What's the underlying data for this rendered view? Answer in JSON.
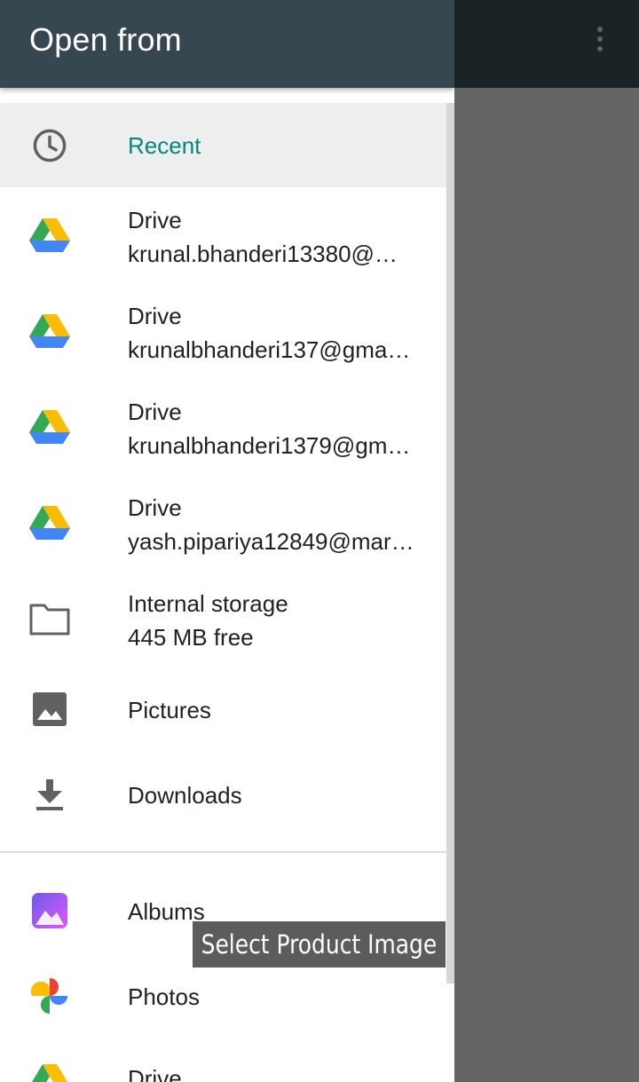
{
  "header": {
    "title": "Open from",
    "menu_icon": "more-vert-icon"
  },
  "items": [
    {
      "key": "recent",
      "label": "Recent",
      "icon": "clock-icon",
      "selected": true
    },
    {
      "key": "drive1",
      "label": "Drive",
      "sub": "krunal.bhanderi13380@…",
      "icon": "google-drive-icon"
    },
    {
      "key": "drive2",
      "label": "Drive",
      "sub": "krunalbhanderi137@gma…",
      "icon": "google-drive-icon"
    },
    {
      "key": "drive3",
      "label": "Drive",
      "sub": "krunalbhanderi1379@gm…",
      "icon": "google-drive-icon"
    },
    {
      "key": "drive4",
      "label": "Drive",
      "sub": "yash.pipariya12849@mar…",
      "icon": "google-drive-icon"
    },
    {
      "key": "storage",
      "label": "Internal storage",
      "sub": "445 MB free",
      "icon": "folder-icon"
    },
    {
      "key": "pictures",
      "label": "Pictures",
      "icon": "image-icon"
    },
    {
      "key": "downloads",
      "label": "Downloads",
      "icon": "download-icon"
    },
    {
      "key": "albums",
      "label": "Albums",
      "icon": "albums-app-icon"
    },
    {
      "key": "photos",
      "label": "Photos",
      "icon": "google-photos-icon"
    },
    {
      "key": "drive5",
      "label": "Drive",
      "icon": "google-drive-icon"
    }
  ],
  "toast": {
    "text": "Select Product Image"
  },
  "colors": {
    "header": "#37474f",
    "accent": "#00897b",
    "selected_bg": "#eeeeee"
  }
}
